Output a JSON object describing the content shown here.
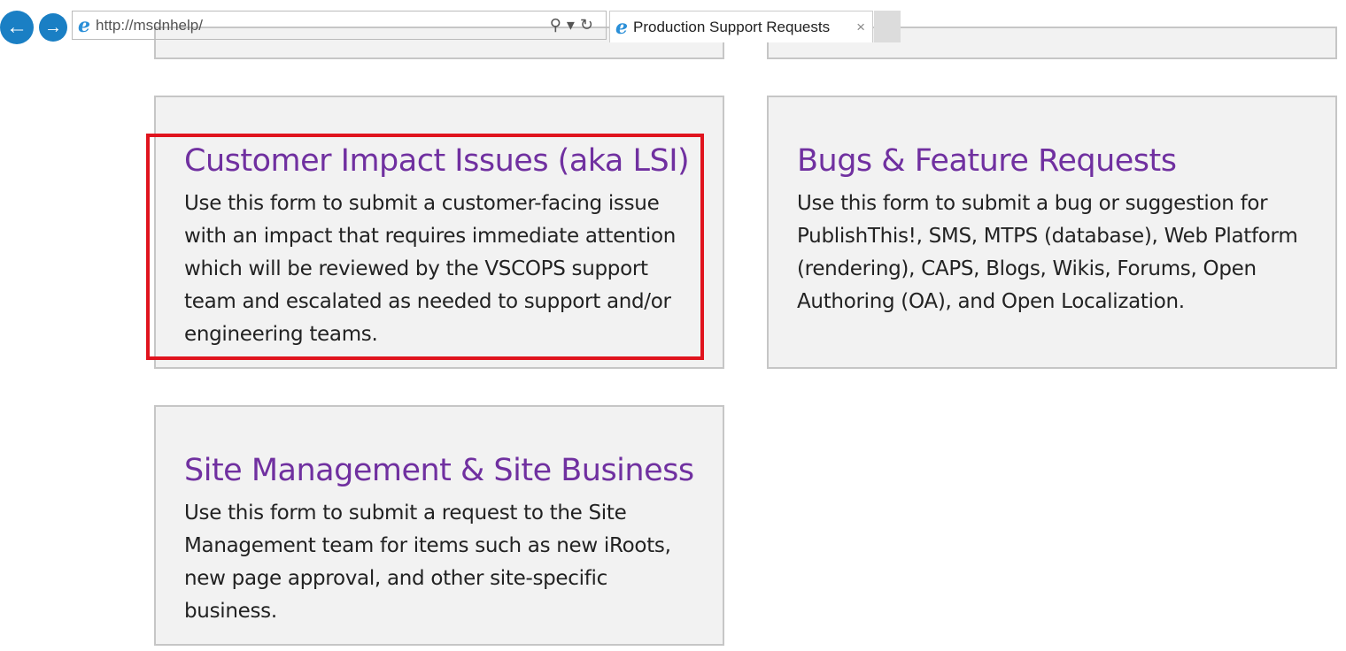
{
  "browser": {
    "url": "http://msdnhelp/",
    "tab_title": "Production Support Requests",
    "close": "×",
    "tools": "⚲▾↻"
  },
  "cards": [
    {
      "title": "Customer Impact Issues (aka LSI)",
      "desc": "Use this form to submit a customer-facing issue with an impact that requires immediate attention which will be reviewed by the VSCOPS support team and escalated as needed to support and/or engineering teams."
    },
    {
      "title": "Bugs & Feature Requests",
      "desc": "Use this form to submit a bug or suggestion for PublishThis!, SMS, MTPS (database), Web Platform (rendering), CAPS, Blogs, Wikis, Forums, Open Authoring (OA), and Open Localization."
    },
    {
      "title": "Site Management & Site Business",
      "desc": "Use this form to submit a request to the Site Management team for items such as new iRoots, new page approval, and other site-specific business."
    }
  ]
}
